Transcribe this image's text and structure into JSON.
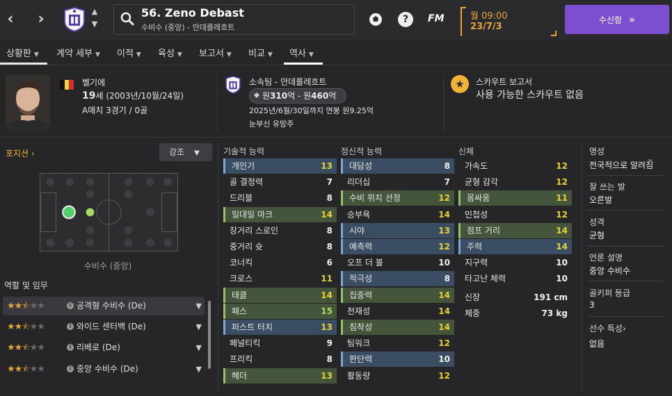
{
  "topbar": {
    "player_name": "56. Zeno Debast",
    "player_sub": "수비수 (중앙) - 안데를레흐트",
    "day_time": "월 09:00",
    "date": "23/7/3",
    "fm_logo": "FM",
    "help": "?",
    "inbox_label": "수신함",
    "inbox_arrow": "»"
  },
  "tabs": [
    {
      "label": "상황판"
    },
    {
      "label": "계약 세부"
    },
    {
      "label": "이적"
    },
    {
      "label": "육성"
    },
    {
      "label": "보고서"
    },
    {
      "label": "비교"
    },
    {
      "label": "역사"
    }
  ],
  "header": {
    "nation": "벨기에",
    "age_num": "19",
    "age_rest": "세 (2003년/10월/24일)",
    "intl": "A매치 3경기 / 0골",
    "club": "소속팀 - 안데를레흐트",
    "value_prefix": "원",
    "value_low": "310",
    "value_mid": "억 - 원",
    "value_high": "460",
    "value_suffix": "억",
    "contract": "2025년/6월/30일까지 연봉 원9.25억",
    "promise": "눈부신 유망주",
    "scout_title": "스카우트 보고서",
    "scout_text": "사용 가능한 스카우트 없음"
  },
  "left": {
    "position_link": "포지션",
    "emphasis_label": "강조",
    "position_caption": "수비수 (중앙)",
    "roles_title": "역할 및 임무",
    "roles": [
      {
        "name": "공격형 수비수 (De)",
        "stars": 2.5
      },
      {
        "name": "와이드 센터백 (De)",
        "stars": 2.5
      },
      {
        "name": "리베로 (De)",
        "stars": 2.5
      },
      {
        "name": "중앙 수비수 (De)",
        "stars": 2.5
      }
    ]
  },
  "attributes": {
    "technical_title": "기술적 능력",
    "mental_title": "정신적 능력",
    "physical_title": "신체",
    "technical": [
      {
        "name": "개인기",
        "value": "13",
        "hl": "blue"
      },
      {
        "name": "골 결정력",
        "value": "7",
        "hl": ""
      },
      {
        "name": "드리블",
        "value": "8",
        "hl": ""
      },
      {
        "name": "일대일 마크",
        "value": "14",
        "hl": "green"
      },
      {
        "name": "장거리 스로인",
        "value": "8",
        "hl": ""
      },
      {
        "name": "중거리 슛",
        "value": "8",
        "hl": ""
      },
      {
        "name": "코너킥",
        "value": "6",
        "hl": ""
      },
      {
        "name": "크로스",
        "value": "11",
        "hl": ""
      },
      {
        "name": "태클",
        "value": "14",
        "hl": "green"
      },
      {
        "name": "패스",
        "value": "15",
        "hl": "green"
      },
      {
        "name": "퍼스트 터치",
        "value": "13",
        "hl": "blue"
      },
      {
        "name": "페널티킥",
        "value": "9",
        "hl": ""
      },
      {
        "name": "프리킥",
        "value": "8",
        "hl": ""
      },
      {
        "name": "헤더",
        "value": "13",
        "hl": "green"
      }
    ],
    "mental": [
      {
        "name": "대담성",
        "value": "8",
        "hl": "blue"
      },
      {
        "name": "리더십",
        "value": "7",
        "hl": ""
      },
      {
        "name": "수비 위치 선정",
        "value": "12",
        "hl": "green"
      },
      {
        "name": "승부욕",
        "value": "14",
        "hl": ""
      },
      {
        "name": "시야",
        "value": "13",
        "hl": "blue"
      },
      {
        "name": "예측력",
        "value": "12",
        "hl": "blue"
      },
      {
        "name": "오프 더 볼",
        "value": "10",
        "hl": ""
      },
      {
        "name": "적극성",
        "value": "8",
        "hl": "blue"
      },
      {
        "name": "집중력",
        "value": "14",
        "hl": "green"
      },
      {
        "name": "천재성",
        "value": "14",
        "hl": ""
      },
      {
        "name": "침착성",
        "value": "14",
        "hl": "green"
      },
      {
        "name": "팀워크",
        "value": "12",
        "hl": ""
      },
      {
        "name": "판단력",
        "value": "10",
        "hl": "blue"
      },
      {
        "name": "활동량",
        "value": "12",
        "hl": ""
      }
    ],
    "physical": [
      {
        "name": "가속도",
        "value": "12",
        "hl": ""
      },
      {
        "name": "균형 감각",
        "value": "12",
        "hl": ""
      },
      {
        "name": "몸싸움",
        "value": "11",
        "hl": "green"
      },
      {
        "name": "민첩성",
        "value": "12",
        "hl": ""
      },
      {
        "name": "점프 거리",
        "value": "14",
        "hl": "green"
      },
      {
        "name": "주력",
        "value": "14",
        "hl": "blue"
      },
      {
        "name": "지구력",
        "value": "10",
        "hl": ""
      },
      {
        "name": "타고난 체력",
        "value": "10",
        "hl": ""
      }
    ],
    "height_label": "신장",
    "height_value": "191 cm",
    "weight_label": "체중",
    "weight_value": "73 kg"
  },
  "side": {
    "reputation_label": "명성",
    "reputation_value": "전국적으로 알려짐",
    "foot_label": "잘 쓰는 발",
    "foot_value": "오른발",
    "personality_label": "성격",
    "personality_value": "균형",
    "media_label": "언론 설명",
    "media_value": "중앙 수비수",
    "gk_label": "골키퍼 등급",
    "gk_value": "3",
    "traits_label": "선수 특성",
    "traits_value": "없음"
  },
  "colors": {
    "accent": "#7b4fd0",
    "date": "#e8a53c",
    "star": "#f0b33a",
    "highlight_blue": "#3b4d62",
    "highlight_green": "#44553b"
  }
}
